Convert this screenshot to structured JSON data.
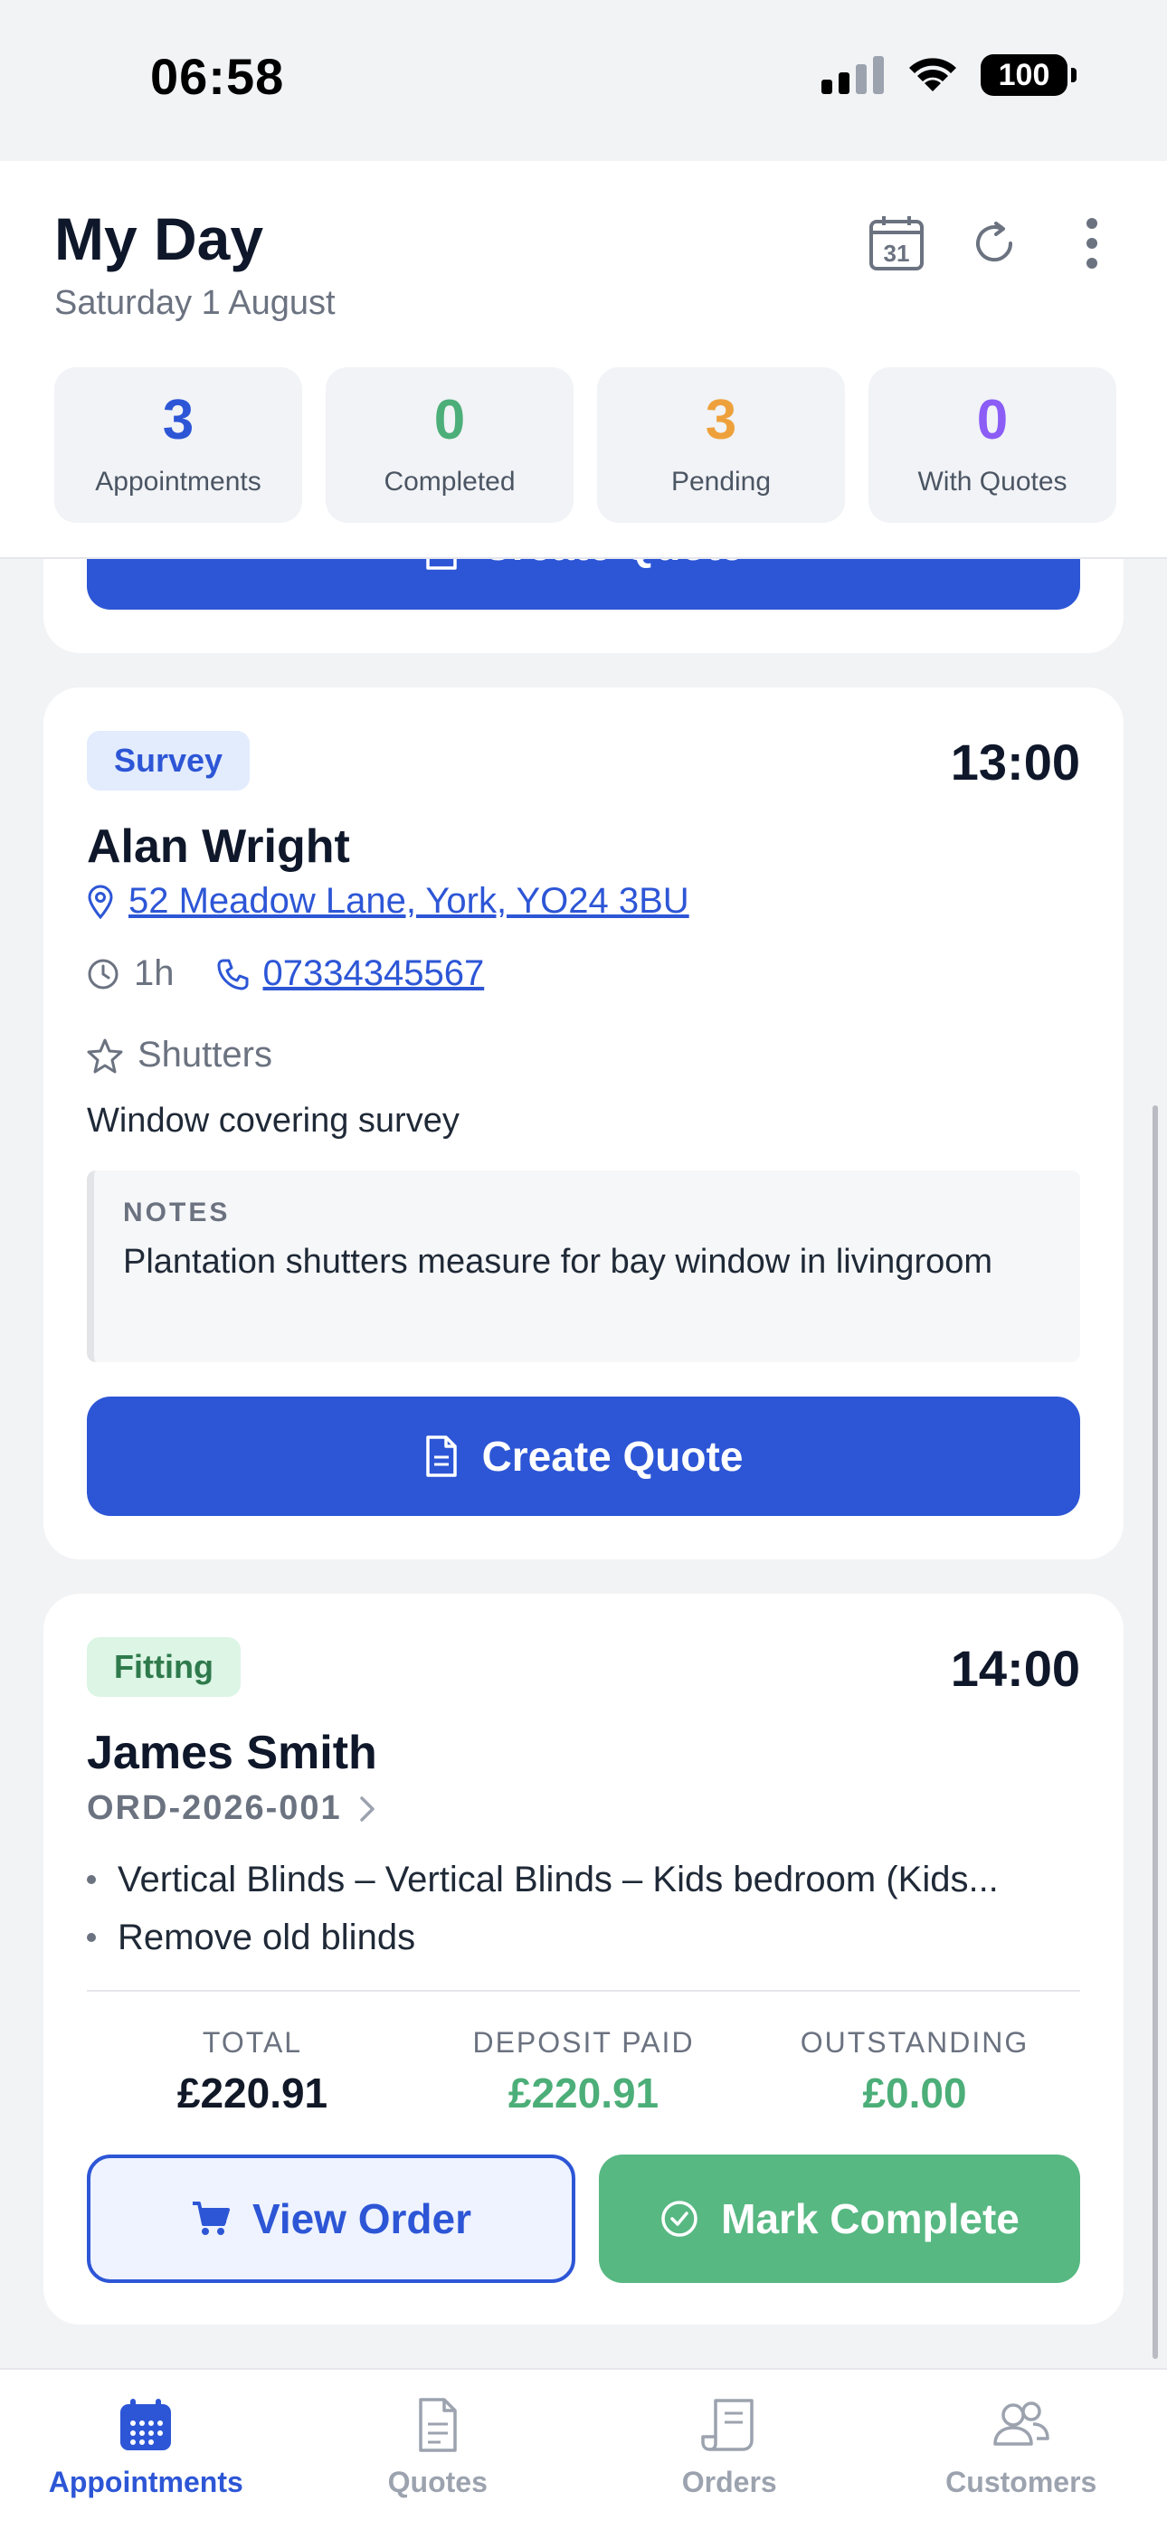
{
  "status_bar": {
    "time": "06:58",
    "battery": "100"
  },
  "header": {
    "title": "My Day",
    "subtitle": "Saturday 1 August",
    "calendar_day": "31"
  },
  "stats": [
    {
      "value": "3",
      "label": "Appointments",
      "color": "#2d56d6"
    },
    {
      "value": "0",
      "label": "Completed",
      "color": "#4cae78"
    },
    {
      "value": "3",
      "label": "Pending",
      "color": "#eea13b"
    },
    {
      "value": "0",
      "label": "With Quotes",
      "color": "#8b5cf6"
    }
  ],
  "prev_card": {
    "button_label": "Create Quote"
  },
  "survey_card": {
    "badge": "Survey",
    "time": "13:00",
    "name": "Alan Wright",
    "address": "52 Meadow Lane, York, YO24 3BU",
    "duration": "1h",
    "phone": "07334345567",
    "product": "Shutters",
    "description": "Window covering survey",
    "notes_label": "NOTES",
    "notes_text": "Plantation shutters measure for bay window in livingroom",
    "button_label": "Create Quote"
  },
  "fitting_card": {
    "badge": "Fitting",
    "time": "14:00",
    "name": "James Smith",
    "order_ref": "ORD-2026-001",
    "items": [
      "Vertical Blinds – Vertical Blinds – Kids bedroom (Kids...",
      "Remove old blinds"
    ],
    "totals": [
      {
        "label": "TOTAL",
        "value": "£220.91",
        "color": "#111827"
      },
      {
        "label": "DEPOSIT PAID",
        "value": "£220.91",
        "color": "#4cae78"
      },
      {
        "label": "OUTSTANDING",
        "value": "£0.00",
        "color": "#4cae78"
      }
    ],
    "view_order_label": "View Order",
    "mark_complete_label": "Mark Complete"
  },
  "tabbar": {
    "tabs": [
      {
        "label": "Appointments",
        "icon": "calendar-icon",
        "active": true
      },
      {
        "label": "Quotes",
        "icon": "document-icon",
        "active": false
      },
      {
        "label": "Orders",
        "icon": "receipt-icon",
        "active": false
      },
      {
        "label": "Customers",
        "icon": "users-icon",
        "active": false
      }
    ],
    "active_color": "#2d56d6",
    "inactive_color": "#9ca3af"
  }
}
